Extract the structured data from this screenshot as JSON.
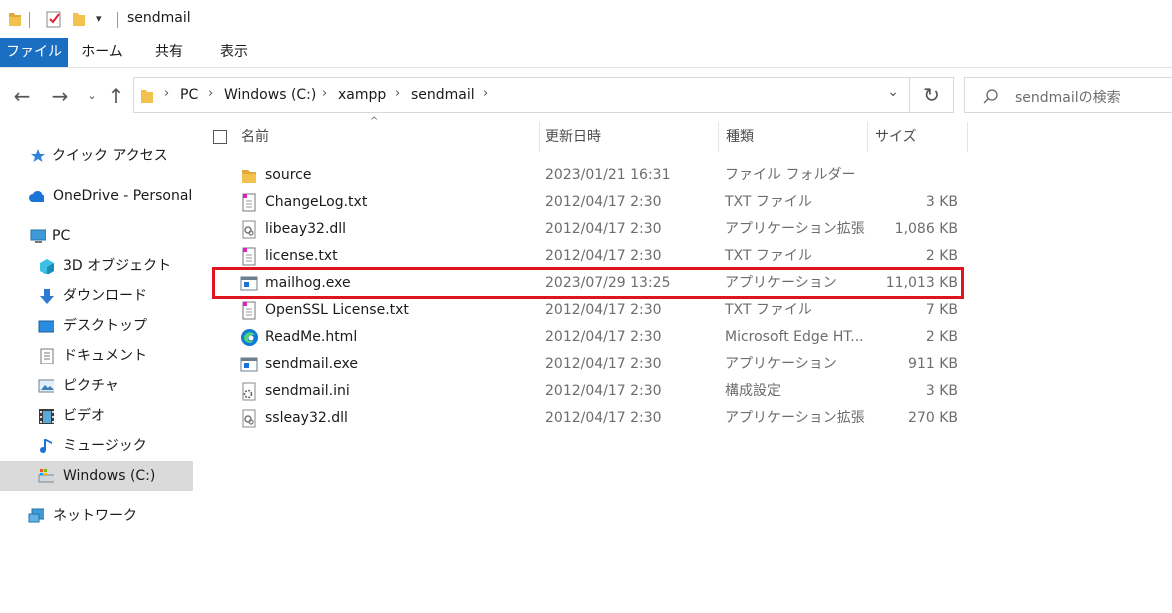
{
  "window": {
    "title": "sendmail"
  },
  "ribbon": {
    "tabs": [
      "ファイル",
      "ホーム",
      "共有",
      "表示"
    ]
  },
  "address": {
    "crumbs": [
      "PC",
      "Windows (C:)",
      "xampp",
      "sendmail"
    ]
  },
  "search": {
    "placeholder": "sendmailの検索"
  },
  "sidebar": {
    "quick_access": "クイック アクセス",
    "onedrive": "OneDrive - Personal",
    "pc": "PC",
    "items": [
      "3D オブジェクト",
      "ダウンロード",
      "デスクトップ",
      "ドキュメント",
      "ピクチャ",
      "ビデオ",
      "ミュージック",
      "Windows (C:)"
    ],
    "network": "ネットワーク"
  },
  "columns": {
    "name": "名前",
    "date": "更新日時",
    "type": "種類",
    "size": "サイズ"
  },
  "files": [
    {
      "name": "source",
      "date": "2023/01/21 16:31",
      "type": "ファイル フォルダー",
      "size": "",
      "icon": "folder-icon"
    },
    {
      "name": "ChangeLog.txt",
      "date": "2012/04/17 2:30",
      "type": "TXT ファイル",
      "size": "3 KB",
      "icon": "text-file-icon"
    },
    {
      "name": "libeay32.dll",
      "date": "2012/04/17 2:30",
      "type": "アプリケーション拡張",
      "size": "1,086 KB",
      "icon": "dll-file-icon"
    },
    {
      "name": "license.txt",
      "date": "2012/04/17 2:30",
      "type": "TXT ファイル",
      "size": "2 KB",
      "icon": "text-file-icon"
    },
    {
      "name": "mailhog.exe",
      "date": "2023/07/29 13:25",
      "type": "アプリケーション",
      "size": "11,013 KB",
      "icon": "exe-file-icon"
    },
    {
      "name": "OpenSSL License.txt",
      "date": "2012/04/17 2:30",
      "type": "TXT ファイル",
      "size": "7 KB",
      "icon": "text-file-icon"
    },
    {
      "name": "ReadMe.html",
      "date": "2012/04/17 2:30",
      "type": "Microsoft Edge HT...",
      "size": "2 KB",
      "icon": "edge-html-icon"
    },
    {
      "name": "sendmail.exe",
      "date": "2012/04/17 2:30",
      "type": "アプリケーション",
      "size": "911 KB",
      "icon": "exe-file-icon"
    },
    {
      "name": "sendmail.ini",
      "date": "2012/04/17 2:30",
      "type": "構成設定",
      "size": "3 KB",
      "icon": "ini-file-icon"
    },
    {
      "name": "ssleay32.dll",
      "date": "2012/04/17 2:30",
      "type": "アプリケーション拡張",
      "size": "270 KB",
      "icon": "dll-file-icon"
    }
  ],
  "colors": {
    "highlight": "#e0141f",
    "file_tab": "#1a6fc2",
    "selected_nav": "#dadada"
  }
}
